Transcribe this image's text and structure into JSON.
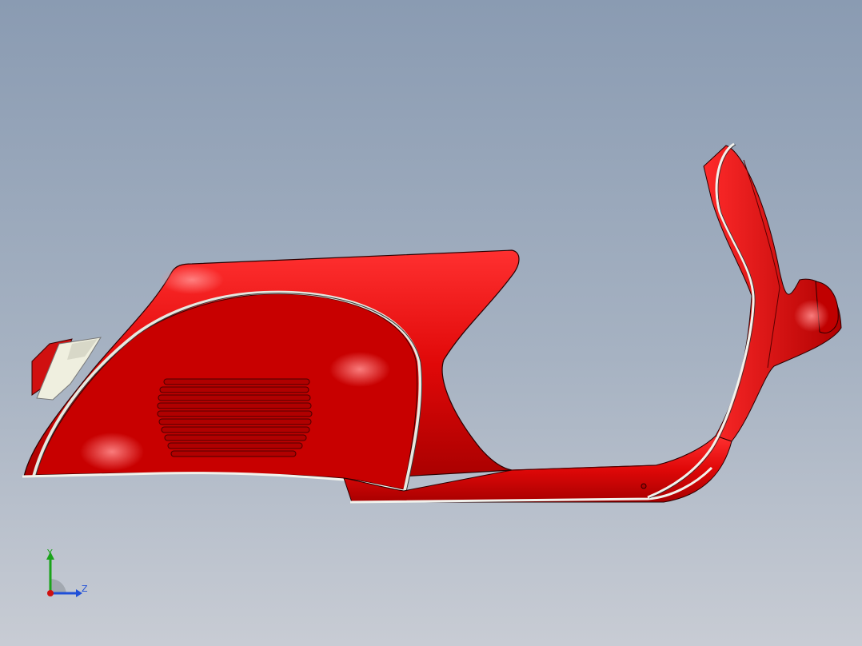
{
  "viewport": {
    "background_top": "#8a9bb2",
    "background_bottom": "#c8ccd4"
  },
  "model": {
    "body_color": "#e00808",
    "shade_color": "#8c0000",
    "highlight_color": "#ff6a6a",
    "trim_color": "#f2f2ec",
    "outline_color": "#2a0000",
    "taillight_lens_color": "#efefdf"
  },
  "triad": {
    "y_label": "Y",
    "z_label": "Z",
    "y_color": "#1aa31a",
    "z_color": "#1f4fd8",
    "x_color": "#d01010"
  }
}
